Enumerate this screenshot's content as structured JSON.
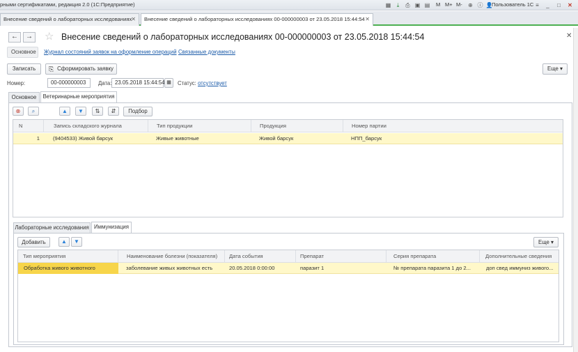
{
  "app": {
    "title": "рными сертификатами, редакция 2.0  (1С:Предприятие)",
    "toolbar_right": {
      "m": "M",
      "m_plus": "M+",
      "m_minus": "M-",
      "user": "Пользователь 1С"
    }
  },
  "window_tabs": [
    {
      "label": "Внесение сведений о лабораторных исследованиях"
    },
    {
      "label": "Внесение сведений о лабораторных исследованиях 00-000000003 от 23.05.2018 15:44:54"
    }
  ],
  "form": {
    "title": "Внесение сведений о лабораторных исследованиях 00-000000003 от 23.05.2018 15:44:54",
    "nav_links": {
      "main": "Основное",
      "journal": "Журнал состояний заявок на оформление операций",
      "related": "Связанные документы"
    },
    "actions": {
      "save": "Записать",
      "create_request": "Сформировать заявку",
      "more": "Еще"
    },
    "fields": {
      "number_label": "Номер:",
      "number_value": "00-000000003",
      "date_label": "Дата:",
      "date_value": "23.05.2018 15:44:54",
      "status_label": "Статус:",
      "status_value": "отсутствует"
    },
    "top_tabs": [
      {
        "label": "Основное"
      },
      {
        "label": "Ветеринарные мероприятия"
      }
    ],
    "top_toolbar": {
      "select_label": "Подбор"
    },
    "top_table": {
      "headers": [
        "N",
        "Запись складского журнала",
        "Тип продукции",
        "Продукция",
        "Номер партии"
      ],
      "rows": [
        {
          "n": "1",
          "record": "(9404533) Живой барсук",
          "product_type": "Живые животные",
          "product": "Живой барсук",
          "batch": "НПП_барсук"
        }
      ]
    },
    "sub_tabs": [
      {
        "label": "Лабораторные исследования"
      },
      {
        "label": "Иммунизация"
      }
    ],
    "bottom_toolbar": {
      "add_label": "Добавить",
      "more": "Еще"
    },
    "bottom_table": {
      "headers": [
        "Тип мероприятия",
        "Наименование болезни (показателя)",
        "Дата события",
        "Препарат",
        "Серия препарата",
        "Дополнительные сведения"
      ],
      "rows": [
        {
          "type": "Обработка живого животного",
          "disease": "заболевание живых животных есть",
          "date": "20.05.2018 0:00:00",
          "drug": "паразит 1",
          "series": "№ препарата паразита 1 до 2...",
          "extra": "доп свед иммуниз живого..."
        }
      ]
    }
  }
}
